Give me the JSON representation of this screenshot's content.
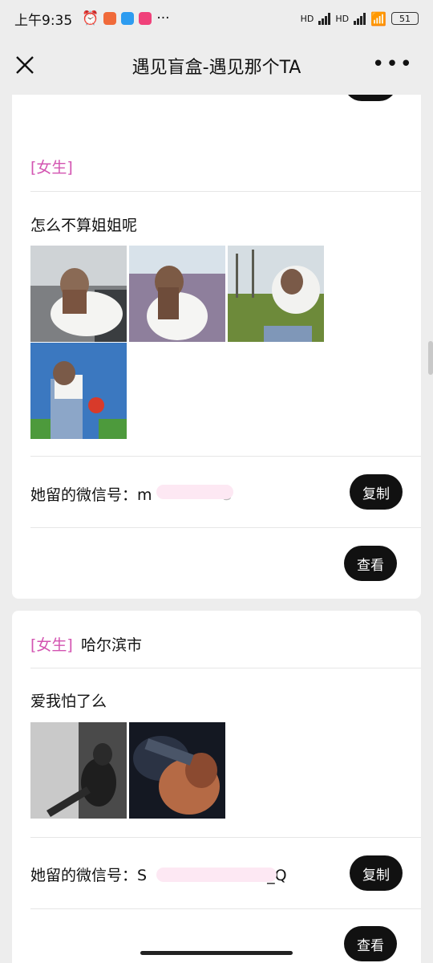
{
  "status": {
    "time": "上午9:35",
    "battery": "51",
    "hd1": "HD",
    "hd2": "HD"
  },
  "nav": {
    "title": "遇见盲盒-遇见那个TA"
  },
  "colors": {
    "gender": "#d354b1",
    "button": "#111111",
    "blur": "#fde8f3"
  },
  "cards": [
    {
      "gender": "[女生]",
      "city": "",
      "text": "怎么不算姐姐呢",
      "wechat_label": "她留的微信号：",
      "wechat_prefix": "m",
      "wechat_suffix": "3",
      "copy": "复制",
      "view": "查看",
      "photos": [
        "girl-car-white-shirt",
        "girl-lavender-field",
        "girl-park-grass",
        "girl-mario-wall"
      ]
    },
    {
      "gender": "[女生]",
      "city": "哈尔滨市",
      "text": "爱我怕了么",
      "wechat_label": "她留的微信号：",
      "wechat_prefix": "S",
      "wechat_suffix": "_Q",
      "copy": "复制",
      "view": "查看",
      "photos": [
        "bw-woman-sitting",
        "woman-dark-lace"
      ]
    }
  ],
  "top_partial_button": ""
}
